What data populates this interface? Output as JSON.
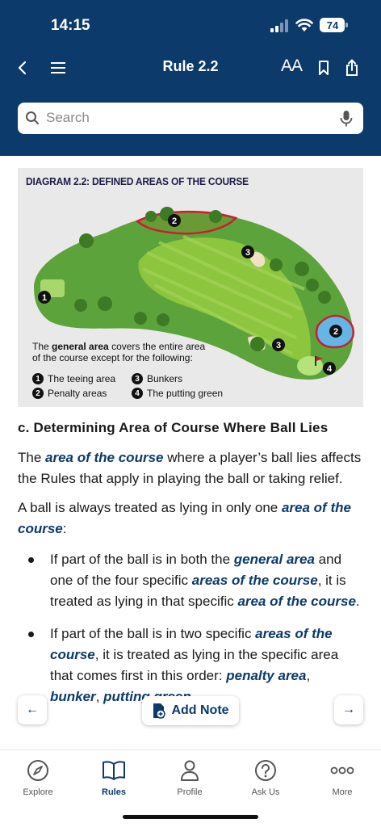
{
  "status": {
    "time": "14:15",
    "battery": "74"
  },
  "nav": {
    "title": "Rule 2.2",
    "font_size_label": "AA"
  },
  "search": {
    "placeholder": "Search"
  },
  "diagram": {
    "title": "DIAGRAM 2.2: DEFINED AREAS OF THE COURSE",
    "caption_pre": "The ",
    "caption_term": "general area",
    "caption_post": " covers the entire area of the course except for the following:",
    "markers": [
      "1",
      "2",
      "3",
      "3",
      "2",
      "4"
    ],
    "legend": [
      {
        "num": "1",
        "label": "The teeing area"
      },
      {
        "num": "2",
        "label": "Penalty areas"
      },
      {
        "num": "3",
        "label": "Bunkers"
      },
      {
        "num": "4",
        "label": "The putting green"
      }
    ]
  },
  "content": {
    "heading": "c. Determining Area of Course Where Ball Lies",
    "p1": {
      "a": "The ",
      "term": "area of the course",
      "b": " where a player’s ball lies affects the Rules that apply in playing the ball or taking relief."
    },
    "p2": {
      "a": "A ball is always treated as lying in only one ",
      "term": "area of the course",
      "b": ":"
    },
    "b1": {
      "a": "If part of the ball is in both the ",
      "t1": "general area",
      "b": " and one of the four specific ",
      "t2": "areas of the course",
      "c": ", it is treated as lying in that specific ",
      "t3": "area of the course",
      "d": "."
    },
    "b2": {
      "a": "If part of the ball is in two specific ",
      "t1": "areas of the course",
      "b": ", it is treated as lying in the specific area that comes first in this order: ",
      "t2": "penalty area",
      "c": ", ",
      "t3": "bunker",
      "d": ", ",
      "t4": "putting green",
      "e": "."
    }
  },
  "toolbar": {
    "prev": "←",
    "next": "→",
    "add_note": "Add Note"
  },
  "tabs": [
    {
      "label": "Explore",
      "icon": "compass-icon"
    },
    {
      "label": "Rules",
      "icon": "book-icon"
    },
    {
      "label": "Profile",
      "icon": "person-icon"
    },
    {
      "label": "Ask Us",
      "icon": "question-icon"
    },
    {
      "label": "More",
      "icon": "more-dots-icon"
    }
  ],
  "colors": {
    "header": "#0b3a6b",
    "term": "#0b3a6b",
    "fairway": "#8cc63f",
    "rough": "#5da33b",
    "water": "#64b6e6",
    "penalty_line": "#c8202f"
  }
}
